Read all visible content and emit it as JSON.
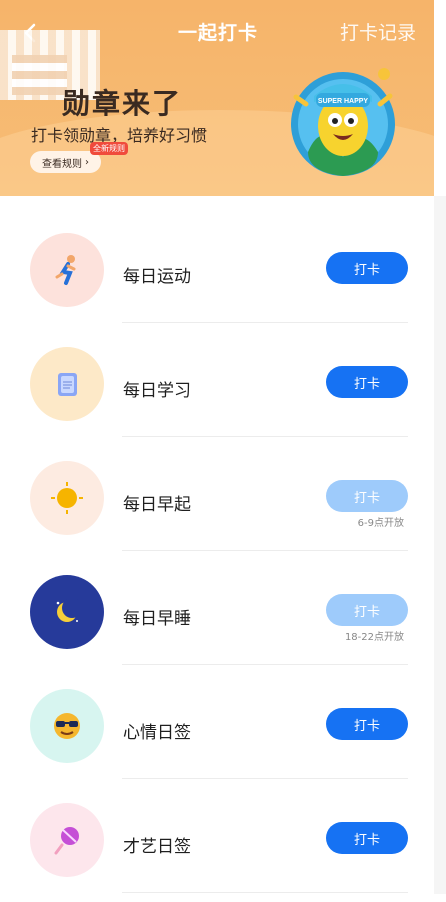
{
  "header": {
    "title": "一起打卡",
    "records_label": "打卡记录",
    "banner_title": "勋章来了",
    "banner_subtitle": "打卡领勋章，培养好习惯",
    "rules_label": "查看规则",
    "new_rules_badge": "全新规则",
    "mascot_hat_text": "SUPER HAPPY"
  },
  "checkins": [
    {
      "name": "每日运动",
      "button": "打卡",
      "status": "active",
      "hint": ""
    },
    {
      "name": "每日学习",
      "button": "打卡",
      "status": "active",
      "hint": ""
    },
    {
      "name": "每日早起",
      "button": "打卡",
      "status": "disabled",
      "hint": "6-9点开放"
    },
    {
      "name": "每日早睡",
      "button": "打卡",
      "status": "disabled",
      "hint": "18-22点开放"
    },
    {
      "name": "心情日签",
      "button": "打卡",
      "status": "active",
      "hint": ""
    },
    {
      "name": "才艺日签",
      "button": "打卡",
      "status": "active",
      "hint": ""
    }
  ],
  "colors": {
    "header_bg": "#f6b46a",
    "button_active": "#1672f3",
    "button_disabled": "#9ecbfb"
  },
  "icons": [
    "back-arrow-icon",
    "running-person-icon",
    "book-icon",
    "sun-icon",
    "moon-icon",
    "sunglasses-face-icon",
    "lollipop-icon"
  ]
}
